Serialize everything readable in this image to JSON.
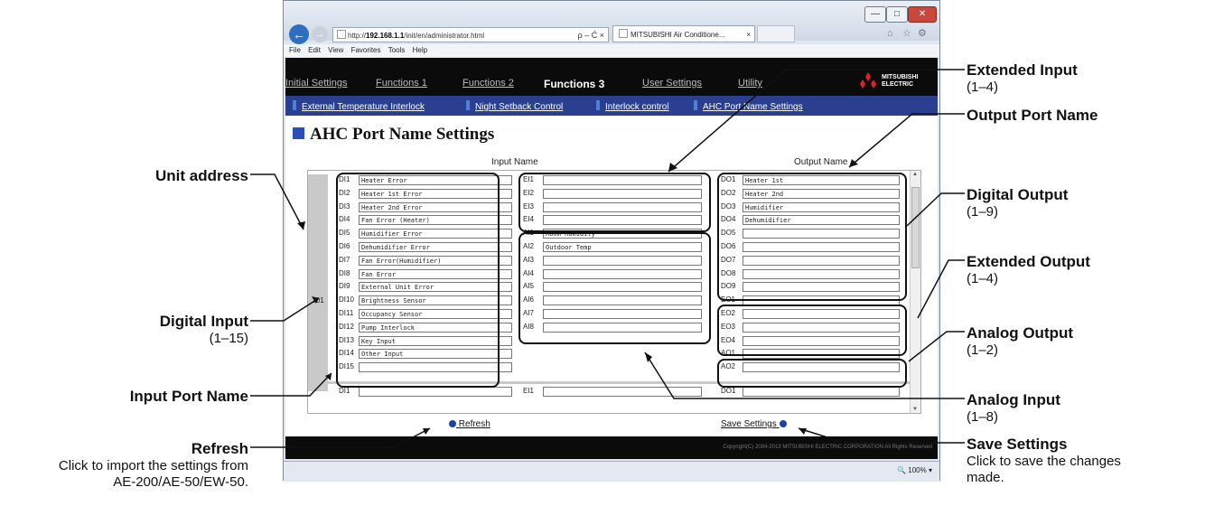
{
  "browser": {
    "address_prefix": "http://",
    "address_host": "192.168.1.1",
    "address_path": "/init/en/administrator.html",
    "address_controls": "ρ – Ć ×",
    "tab_title": "MITSUBISHI Air Conditione...",
    "menu": [
      "File",
      "Edit",
      "View",
      "Favorites",
      "Tools",
      "Help"
    ],
    "zoom": "100%"
  },
  "nav": {
    "main": [
      "Initial Settings",
      "Functions 1",
      "Functions 2",
      "Functions 3",
      "User Settings",
      "Utility"
    ],
    "active_main": "Functions 3",
    "sub": [
      "External Temperature Interlock",
      "Night Setback Control",
      "Interlock control",
      "AHC Port Name Settings"
    ],
    "logo_line1": "MITSUBISHI",
    "logo_line2": "ELECTRIC"
  },
  "page": {
    "title": "AHC Port Name Settings",
    "input_header": "Input Name",
    "output_header": "Output Name",
    "unit_address": "201",
    "refresh_label": "Refresh",
    "save_label": "Save Settings",
    "copyright": "Copyright(C) 2004-2013 MITSUBISHI ELECTRIC CORPORATION All Rights Reserved"
  },
  "digital_inputs": [
    {
      "label": "DI1",
      "value": "Heater Error"
    },
    {
      "label": "DI2",
      "value": "Heater 1st Error"
    },
    {
      "label": "DI3",
      "value": "Heater 2nd Error"
    },
    {
      "label": "DI4",
      "value": "Fan Error (Heater)"
    },
    {
      "label": "DI5",
      "value": "Humidifier Error"
    },
    {
      "label": "DI6",
      "value": "Dehumidifier Error"
    },
    {
      "label": "DI7",
      "value": "Fan Error(Humidifier)"
    },
    {
      "label": "DI8",
      "value": "Fan Error"
    },
    {
      "label": "DI9",
      "value": "External Unit Error"
    },
    {
      "label": "DI10",
      "value": "Brightness Sensor"
    },
    {
      "label": "DI11",
      "value": "Occupancy Sensor"
    },
    {
      "label": "DI12",
      "value": "Pump Interlock"
    },
    {
      "label": "DI13",
      "value": "Key Input"
    },
    {
      "label": "DI14",
      "value": "Other Input"
    },
    {
      "label": "DI15",
      "value": ""
    }
  ],
  "extended_inputs": [
    {
      "label": "EI1",
      "value": ""
    },
    {
      "label": "EI2",
      "value": ""
    },
    {
      "label": "EI3",
      "value": ""
    },
    {
      "label": "EI4",
      "value": ""
    }
  ],
  "analog_inputs": [
    {
      "label": "AI1",
      "value": "Room Humidity"
    },
    {
      "label": "AI2",
      "value": "Outdoor Temp"
    },
    {
      "label": "AI3",
      "value": ""
    },
    {
      "label": "AI4",
      "value": ""
    },
    {
      "label": "AI5",
      "value": ""
    },
    {
      "label": "AI6",
      "value": ""
    },
    {
      "label": "AI7",
      "value": ""
    },
    {
      "label": "AI8",
      "value": ""
    }
  ],
  "digital_outputs": [
    {
      "label": "DO1",
      "value": "Heater 1st"
    },
    {
      "label": "DO2",
      "value": "Heater 2nd"
    },
    {
      "label": "DO3",
      "value": "Humidifier"
    },
    {
      "label": "DO4",
      "value": "Dehumidifier"
    },
    {
      "label": "DO5",
      "value": ""
    },
    {
      "label": "DO6",
      "value": ""
    },
    {
      "label": "DO7",
      "value": ""
    },
    {
      "label": "DO8",
      "value": ""
    },
    {
      "label": "DO9",
      "value": ""
    }
  ],
  "extended_outputs": [
    {
      "label": "EO1",
      "value": ""
    },
    {
      "label": "EO2",
      "value": ""
    },
    {
      "label": "EO3",
      "value": ""
    },
    {
      "label": "EO4",
      "value": ""
    }
  ],
  "analog_outputs": [
    {
      "label": "AO1",
      "value": ""
    },
    {
      "label": "AO2",
      "value": ""
    }
  ],
  "next_unit_rows": [
    {
      "label": "DI1",
      "value": ""
    },
    {
      "label": "EI1",
      "value": ""
    },
    {
      "label": "DO1",
      "value": ""
    }
  ],
  "callouts": {
    "extended_input": {
      "title": "Extended Input",
      "sub": "(1–4)"
    },
    "output_port_name": {
      "title": "Output Port Name"
    },
    "digital_output": {
      "title": "Digital Output",
      "sub": "(1–9)"
    },
    "extended_output": {
      "title": "Extended Output",
      "sub": "(1–4)"
    },
    "analog_output": {
      "title": "Analog Output",
      "sub": "(1–2)"
    },
    "analog_input": {
      "title": "Analog Input",
      "sub": "(1–8)"
    },
    "save_settings": {
      "title": "Save Settings",
      "sub": "Click to save the changes made."
    },
    "unit_address": {
      "title": "Unit address"
    },
    "digital_input": {
      "title": "Digital Input",
      "sub": "(1–15)"
    },
    "input_port_name": {
      "title": "Input Port Name"
    },
    "refresh": {
      "title": "Refresh",
      "sub": "Click to import the settings from AE-200/AE-50/EW-50."
    }
  }
}
